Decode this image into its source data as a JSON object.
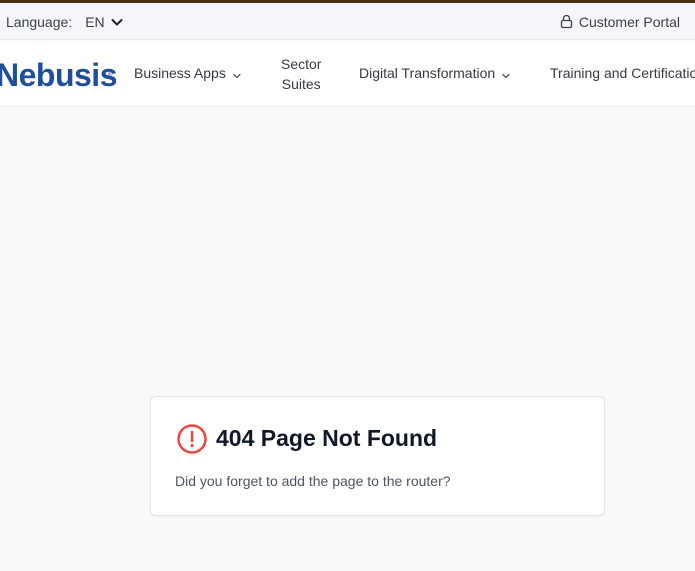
{
  "topbar": {
    "language_label": "Language:",
    "language_value": "EN",
    "portal_label": "Customer Portal"
  },
  "navbar": {
    "logo_text": "Nebusis",
    "items": [
      {
        "label": "Business Apps",
        "has_dropdown": true
      },
      {
        "label_line1": "Sector",
        "label_line2": "Suites",
        "has_dropdown": false
      },
      {
        "label": "Digital Transformation",
        "has_dropdown": true
      },
      {
        "label": "Training and Certification",
        "has_dropdown": false
      }
    ]
  },
  "error_card": {
    "title": "404 Page Not Found",
    "message": "Did you forget to add the page to the router?"
  },
  "colors": {
    "top_stripe": "#4a2e14",
    "logo_blue": "#1f4e9a",
    "error_red": "#ef4444",
    "page_bg": "#f8f9fb"
  },
  "icons": {
    "language_chevron": "chevron-down-icon",
    "portal": "lock-icon",
    "nav_caret": "chevron-down-icon",
    "error": "alert-circle-icon"
  }
}
